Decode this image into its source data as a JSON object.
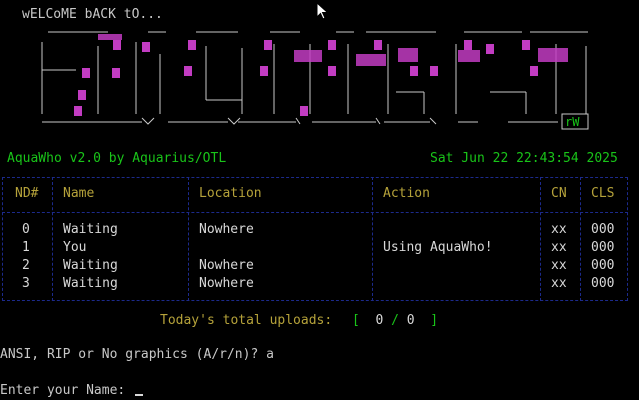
{
  "welcome": "wELCoME bACK tO...",
  "banner": {
    "tag": "rW"
  },
  "status": {
    "app": "AquaWho v2.0 by Aquarius/OTL",
    "datetime": "Sat Jun 22 22:43:54 2025"
  },
  "table": {
    "headers": [
      "ND#",
      "Name",
      "Location",
      "Action",
      "CN",
      "CLS"
    ],
    "rows": [
      {
        "nd": "0",
        "name": "Waiting",
        "location": "Nowhere",
        "action": "",
        "cn": "xx",
        "cls": "000"
      },
      {
        "nd": "1",
        "name": "You",
        "location": "",
        "action": "Using AquaWho!",
        "cn": "xx",
        "cls": "000"
      },
      {
        "nd": "2",
        "name": "Waiting",
        "location": "Nowhere",
        "action": "",
        "cn": "xx",
        "cls": "000"
      },
      {
        "nd": "3",
        "name": "Waiting",
        "location": "Nowhere",
        "action": "",
        "cn": "xx",
        "cls": "000"
      }
    ]
  },
  "uploads": {
    "label": "Today's total uploads:",
    "open": "[",
    "current": "0",
    "sep": "/",
    "total": "0",
    "close": "]"
  },
  "prompts": {
    "graphics": "ANSI, RIP or No graphics (A/r/n)? a",
    "name": "Enter your Name:"
  },
  "colors": {
    "green": "#19c419",
    "gold": "#b5a23a",
    "magenta": "#c23cc2",
    "frame": "#1c2a8c"
  }
}
